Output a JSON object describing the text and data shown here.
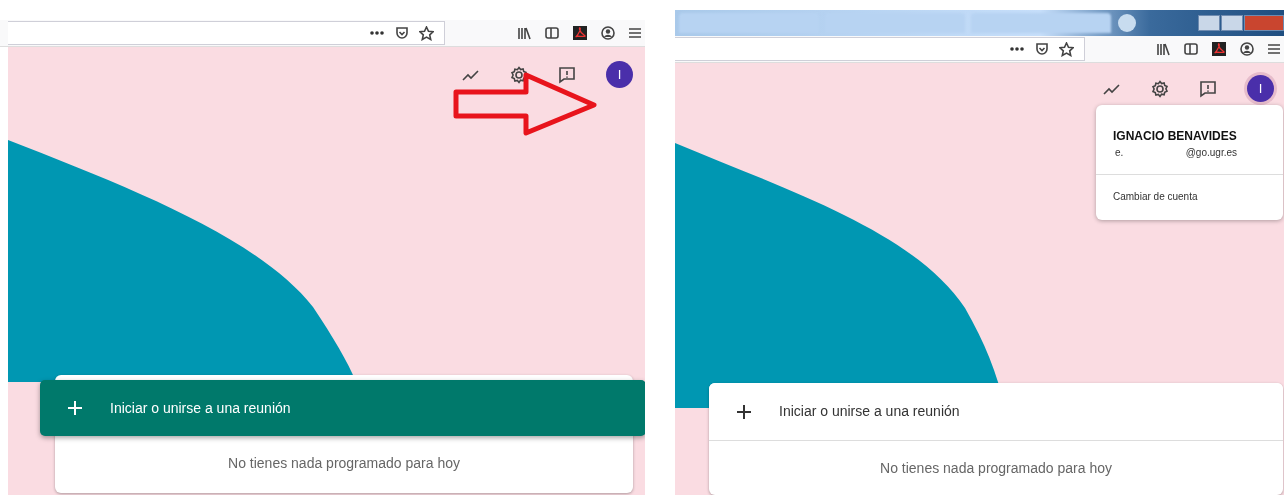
{
  "panels": [
    {
      "tab_strip": false,
      "arrow": true,
      "avatar_initial": "I",
      "start_meeting": {
        "label": "Iniciar o unirse a una reunión",
        "hovered": true
      },
      "schedule_note": "No tienes nada programado para hoy"
    },
    {
      "tab_strip": true,
      "arrow": false,
      "avatar_initial": "I",
      "start_meeting": {
        "label": "Iniciar o unirse a una reunión",
        "hovered": false
      },
      "schedule_note": "No tienes nada programado para hoy",
      "account_menu": {
        "name": "IGNACIO BENAVIDES",
        "email_prefix": "e.",
        "email_domain": "@go.ugr.es",
        "switch_account": "Cambiar de cuenta"
      }
    }
  ]
}
